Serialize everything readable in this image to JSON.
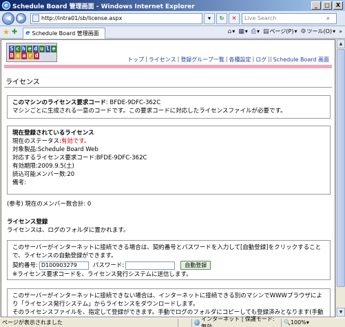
{
  "window": {
    "title": "Schedule Board 管理画面 - Windows Internet Explorer",
    "buttons": [
      "_",
      "□",
      "X"
    ]
  },
  "address_bar": {
    "url": "http://intra01/sb/license.aspx",
    "search_placeholder": "Live Search"
  },
  "tab": {
    "label": "Schedule Board 管理画面"
  },
  "commands": {
    "page": "ページ(P)",
    "tools": "ツール(O)",
    "more": "»"
  },
  "logo": {
    "line1": "Schedule",
    "line2": "Board"
  },
  "topnav": {
    "items": [
      "トップ",
      "ライセンス",
      "登録グループ一覧",
      "各種設定",
      "ログ"
    ],
    "separator": "|",
    "double_separator": "||",
    "last": "Schedule Board 画面"
  },
  "main": {
    "page_title": "ライセンス",
    "request_code_box": {
      "label": "このマシンのライセンス要求コード",
      "colon": ":",
      "code": "BFDE-9DFC-362C",
      "note": "マシンごとに生成される一意のコードです。この要求コードに対応したライセンスファイルが必要です。"
    },
    "current_license": {
      "heading": "現在登録されているライセンス",
      "status_label": "現在のステータス:",
      "status_value": "有効です。",
      "product_label": "対象製品:",
      "product_value": "Schedule Board Web",
      "code_label": "対応するライセンス要求コード:",
      "code_value": "BFDE-9DFC-362C",
      "expiry_label": "有効期限:",
      "expiry_value": "2009.9.5(土)",
      "members_label": "読込可能メンバー数:",
      "members_value": "20",
      "notes_label": "備考:",
      "notes_value": ""
    },
    "member_total": "(参考) 現在のメンバー数合計: 0",
    "register": {
      "heading": "ライセンス登録",
      "desc": "ライセンスは、ログのフォルダに置かれます。",
      "online_box": {
        "text": "このサーバーがインターネットに接続できる場合は、契約番号とパスワードを入力して[自動登録]をクリックすることで、ライセンスの自動登録ができます。",
        "contract_label": "契約番号:",
        "contract_value": "D100903279",
        "password_label": "パスワード:",
        "password_value": "",
        "button": "自動登録",
        "note": "※ライセンス要求コードを、ライセンス発行システムに送信します。"
      },
      "offline_box": {
        "text": "このサーバーがインターネットに接続できない場合は、インターネットに接続できる別のマシンでWWWブラウザにより「ライセンス発行システム」からライセンスをダウンロードします。",
        "text2": "そのライセンスファイルを、指定して登録ができます。手動でログのフォルダにコピーしても登録済みとなります(手動登録"
      }
    }
  },
  "statusbar": {
    "message": "ページが表示されました",
    "zone": "インターネット | 保護モード: 無効",
    "zoom": "100%"
  }
}
